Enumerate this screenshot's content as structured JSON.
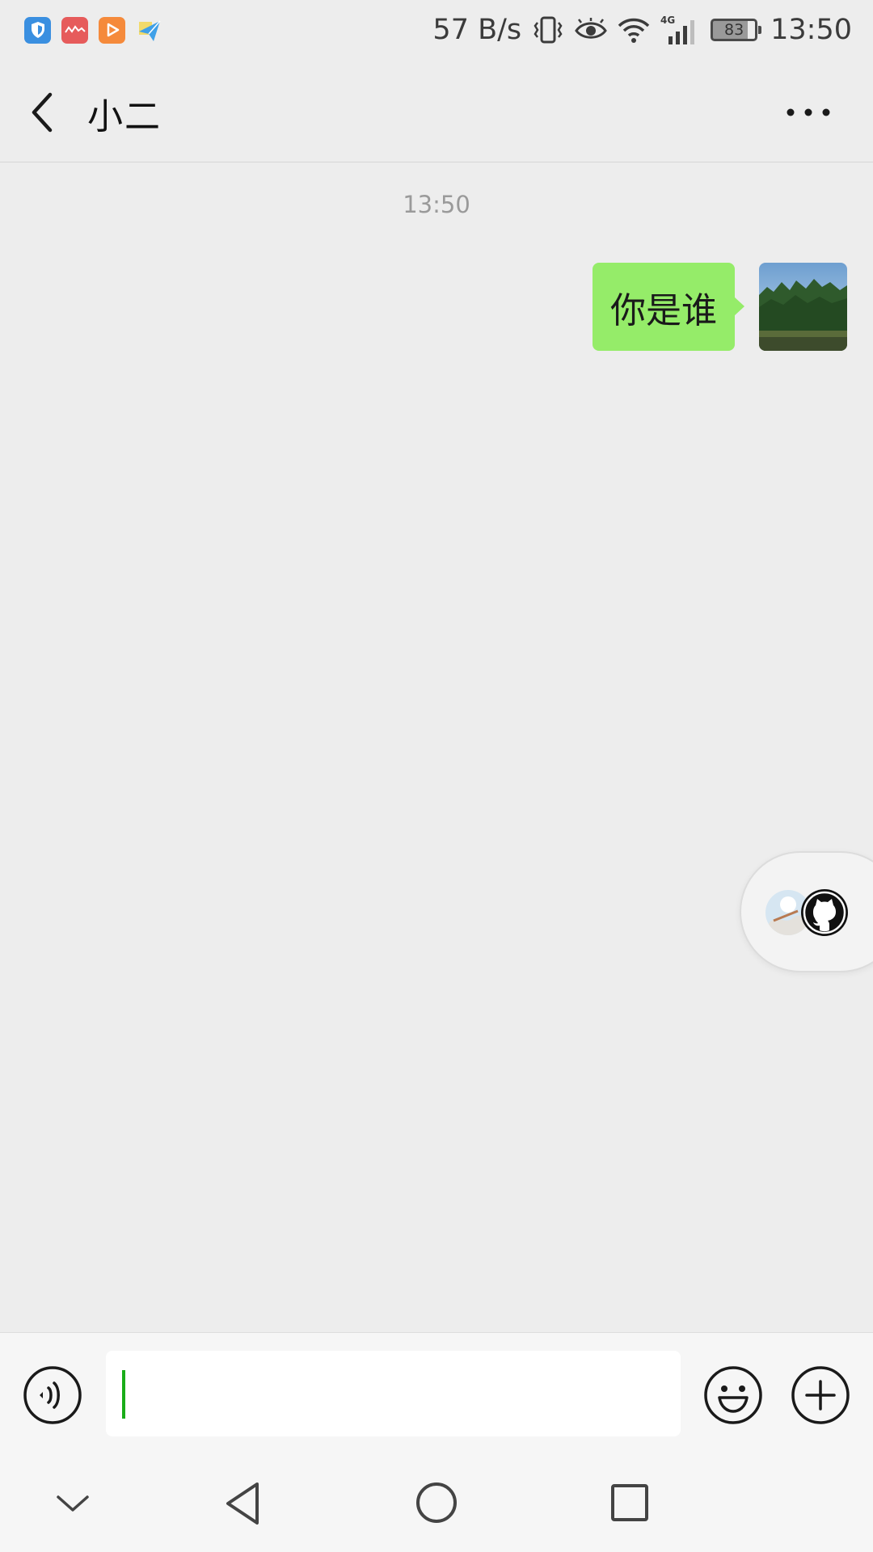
{
  "status_bar": {
    "net_speed": "57 B/s",
    "battery": "83",
    "time": "13:50",
    "network": "4G",
    "icons": [
      "shield-app-icon",
      "red-app-icon",
      "video-app-icon",
      "paper-plane-app-icon",
      "vibrate-icon",
      "eye-icon",
      "wifi-icon",
      "signal-icon",
      "battery-icon"
    ]
  },
  "header": {
    "title": "小二",
    "back_icon": "chevron-left-icon",
    "more_icon": "more-icon"
  },
  "chat": {
    "timestamp": "13:50",
    "messages": [
      {
        "sender": "me",
        "text": "你是谁"
      }
    ]
  },
  "colors": {
    "background": "#ededed",
    "bubble_green": "#95ec69",
    "cursor_green": "#1aad19"
  },
  "input_bar": {
    "value": "",
    "icons": [
      "voice-icon",
      "emoji-icon",
      "plus-icon"
    ]
  },
  "nav_bar": {
    "icons": [
      "hide-keyboard-icon",
      "back-triangle-icon",
      "home-circle-icon",
      "recents-square-icon"
    ]
  }
}
